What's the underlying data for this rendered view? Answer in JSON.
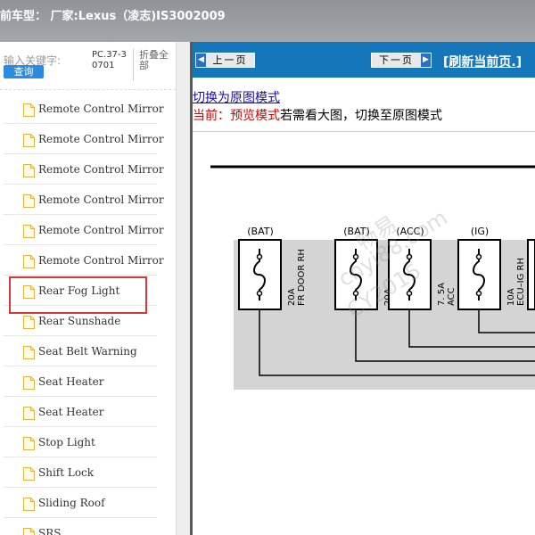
{
  "header": {
    "title": "前车型： 厂家:Lexus（凌志)IS3002009"
  },
  "search": {
    "label": "输入关键字:",
    "button": "查询"
  },
  "pc_code": "PC.37-30701",
  "collapse_all": "折叠全部",
  "tree": {
    "items": [
      {
        "label": "Remote Control Mirror"
      },
      {
        "label": "Remote Control Mirror"
      },
      {
        "label": "Remote Control Mirror"
      },
      {
        "label": "Remote Control Mirror"
      },
      {
        "label": "Remote Control Mirror"
      },
      {
        "label": "Remote Control Mirror"
      },
      {
        "label": "Rear Fog Light",
        "highlighted": true
      },
      {
        "label": "Rear Sunshade"
      },
      {
        "label": "Seat Belt Warning"
      },
      {
        "label": "Seat Heater"
      },
      {
        "label": "Seat Heater"
      },
      {
        "label": "Stop Light"
      },
      {
        "label": "Shift Lock"
      },
      {
        "label": "Sliding Roof"
      },
      {
        "label": "SRS"
      }
    ]
  },
  "nav": {
    "prev": "上一页",
    "next": "下一页",
    "refresh": "[刷新当前页.]"
  },
  "view": {
    "switch_link": "切换为原图模式",
    "status_prefix": "当前：预览模式",
    "status_suffix": "若需看大图，切换至原图模式"
  },
  "diagram": {
    "fuses": [
      {
        "source": "(BAT)",
        "rating": "20A",
        "name": "FR DOOR RH"
      },
      {
        "source": "(BAT)",
        "rating": "20A",
        "name": "TI&TE"
      },
      {
        "source": "(ACC)",
        "rating": "7. 5A",
        "name": "ACC"
      },
      {
        "source": "(IG)",
        "rating": "10A",
        "name": "ECU–IG RH"
      }
    ],
    "watermark_lines": [
      "畅易",
      "cnyi88.com",
      "CY2015"
    ]
  },
  "colors": {
    "header_bg": "#9a9da2",
    "nav_bg": "#1577b9",
    "highlight_border": "#d9373a",
    "link": "#1a0dab",
    "status_red": "#d40000"
  }
}
